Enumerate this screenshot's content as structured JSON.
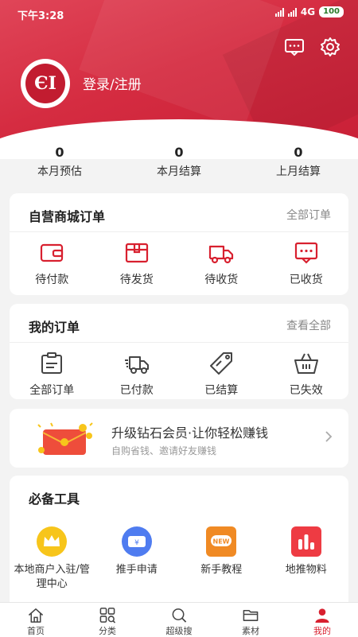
{
  "status_bar": {
    "time": "下午3:28",
    "network": "4G",
    "battery": "100"
  },
  "profile": {
    "avatar_text": "ЄI",
    "login_label": "登录/注册"
  },
  "stats": [
    {
      "value": "0",
      "label": "本月预估"
    },
    {
      "value": "0",
      "label": "本月结算"
    },
    {
      "value": "0",
      "label": "上月结算"
    }
  ],
  "mall_orders": {
    "title": "自营商城订单",
    "link": "全部订单",
    "items": [
      {
        "label": "待付款",
        "icon": "wallet-icon"
      },
      {
        "label": "待发货",
        "icon": "package-icon"
      },
      {
        "label": "待收货",
        "icon": "truck-icon"
      },
      {
        "label": "已收货",
        "icon": "message-icon"
      }
    ]
  },
  "my_orders": {
    "title": "我的订单",
    "link": "查看全部",
    "items": [
      {
        "label": "全部订单",
        "icon": "clipboard-icon"
      },
      {
        "label": "已付款",
        "icon": "delivery-truck-icon"
      },
      {
        "label": "已结算",
        "icon": "tag-icon"
      },
      {
        "label": "已失效",
        "icon": "basket-icon"
      }
    ]
  },
  "promo": {
    "title": "升级钻石会员·让你轻松赚钱",
    "subtitle": "自购省钱、邀请好友赚钱"
  },
  "tools": {
    "title": "必备工具",
    "items": [
      {
        "label": "本地商户入驻/管理中心",
        "icon": "crown-icon",
        "color": "#f7c51b"
      },
      {
        "label": "推手申请",
        "icon": "coupon-icon",
        "color": "#4f7cf0"
      },
      {
        "label": "新手教程",
        "icon": "new-badge-icon",
        "color": "#f08a24"
      },
      {
        "label": "地推物料",
        "icon": "bar-chart-icon",
        "color": "#ee3b43"
      }
    ]
  },
  "tabs": [
    {
      "label": "首页"
    },
    {
      "label": "分类"
    },
    {
      "label": "超级搜"
    },
    {
      "label": "素材"
    },
    {
      "label": "我的"
    }
  ],
  "colors": {
    "brand_red": "#d52c41",
    "active_tab": "#d8202f"
  }
}
